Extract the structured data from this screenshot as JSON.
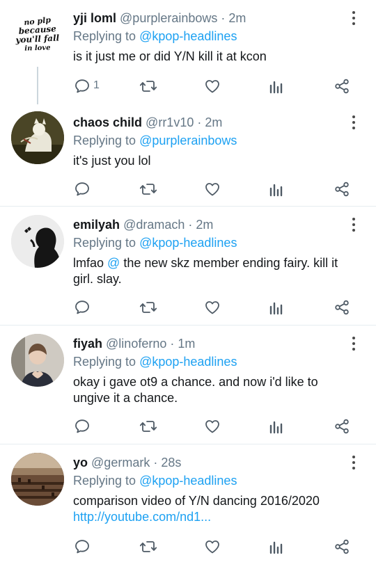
{
  "tweets": [
    {
      "name": "yji loml",
      "handle": "@purplerainbows",
      "time": "· 2m",
      "reply_prefix": "Replying to",
      "reply_handle": "@kpop-headlines",
      "text": "is it just me or did Y/N kill it at kcon",
      "link": "",
      "reply_count": "1",
      "avatar_text": [
        "no plp",
        "because",
        "you'll fall",
        "in love"
      ]
    },
    {
      "name": "chaos child",
      "handle": "@rr1v10",
      "time": "· 2m",
      "reply_prefix": "Replying to",
      "reply_handle": "@purplerainbows",
      "text": "it's just you lol",
      "link": "",
      "reply_count": ""
    },
    {
      "name": "emilyah",
      "handle": "@dramach",
      "time": "· 2m",
      "reply_prefix": "Replying to",
      "reply_handle": "@kpop-headlines",
      "text_before": "lmfao ",
      "mention": "@",
      "text_after": " the new skz member ending fairy. kill it girl. slay.",
      "link": "",
      "reply_count": ""
    },
    {
      "name": "fiyah",
      "handle": "@linoferno",
      "time": "· 1m",
      "reply_prefix": "Replying to",
      "reply_handle": "@kpop-headlines",
      "text": "okay i gave ot9 a chance. and now i'd like to ungive it a chance.",
      "link": "",
      "reply_count": ""
    },
    {
      "name": "yo",
      "handle": "@germark",
      "time": "· 28s",
      "reply_prefix": "Replying to",
      "reply_handle": "@kpop-headlines",
      "text": "comparison video of Y/N dancing 2016/2020",
      "link": "http://youtube.com/nd1...",
      "reply_count": ""
    }
  ],
  "icons": {
    "reply": "reply-icon",
    "retweet": "retweet-icon",
    "like": "heart-icon",
    "stats": "stats-icon",
    "share": "share-icon",
    "more": "more-vertical-icon"
  },
  "colors": {
    "link": "#1da1f2",
    "muted": "#657786",
    "icon": "#4e5a65",
    "divider": "#e6ecf0"
  }
}
